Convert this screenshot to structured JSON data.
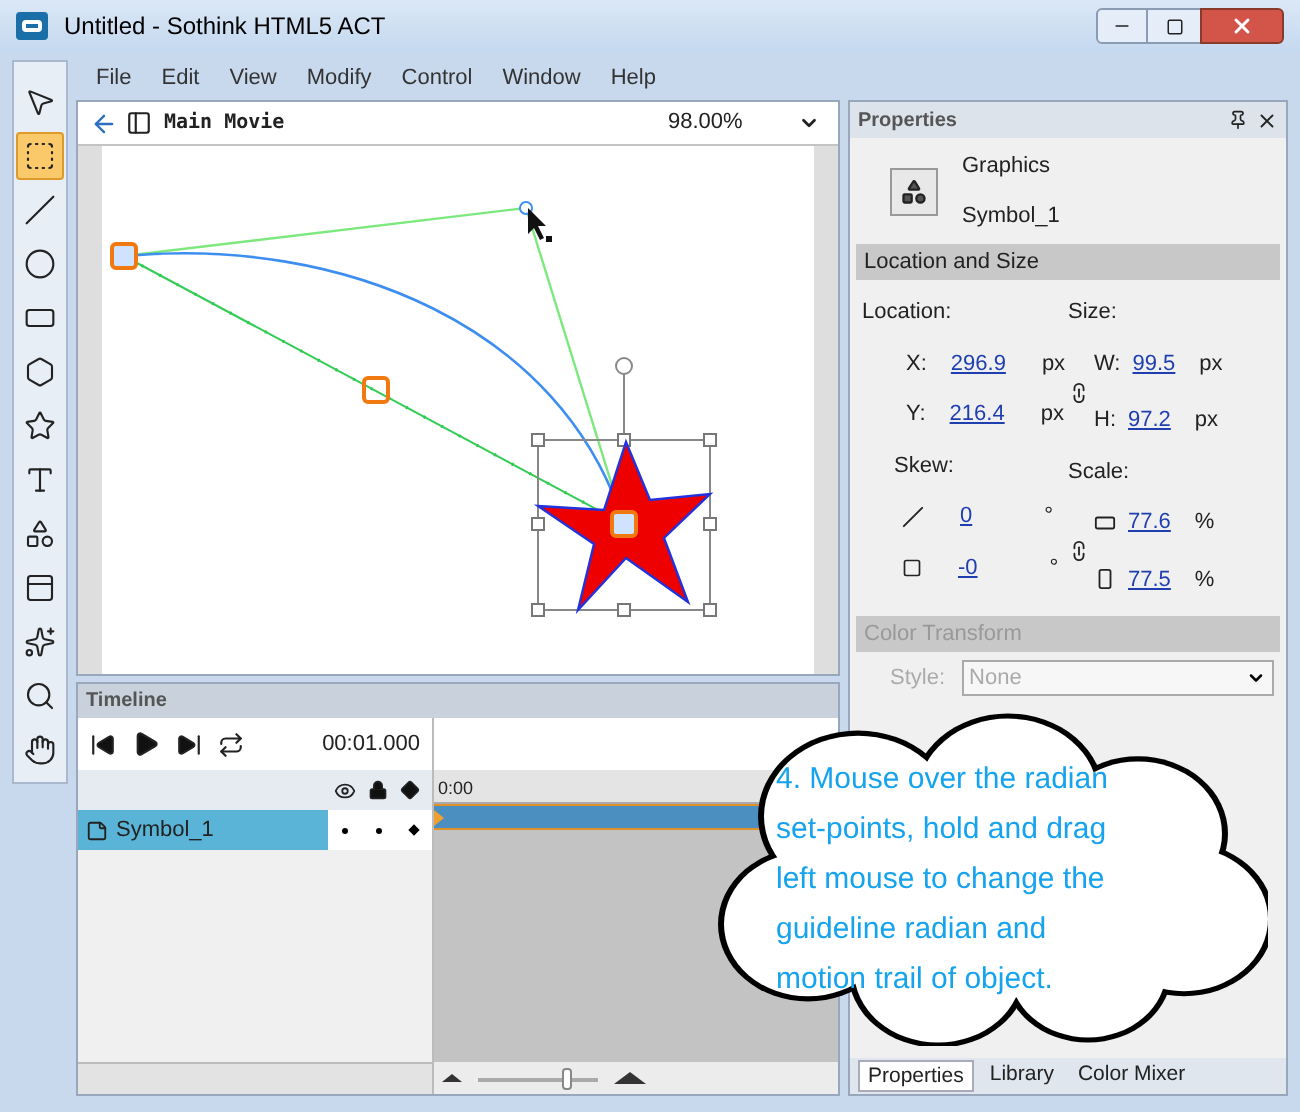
{
  "window": {
    "title": "Untitled - Sothink HTML5 ACT"
  },
  "menu": [
    "File",
    "Edit",
    "View",
    "Modify",
    "Control",
    "Window",
    "Help"
  ],
  "tools": [
    {
      "kind": "pointer",
      "selected": false
    },
    {
      "kind": "transform",
      "selected": true
    },
    {
      "kind": "line",
      "selected": false
    },
    {
      "kind": "ellipse",
      "selected": false
    },
    {
      "kind": "rectangle",
      "selected": false
    },
    {
      "kind": "polygon",
      "selected": false
    },
    {
      "kind": "star",
      "selected": false
    },
    {
      "kind": "text",
      "selected": false
    },
    {
      "kind": "symbol",
      "selected": false
    },
    {
      "kind": "frame",
      "selected": false
    },
    {
      "kind": "effect",
      "selected": false
    },
    {
      "kind": "zoom",
      "selected": false
    },
    {
      "kind": "hand",
      "selected": false
    }
  ],
  "stage": {
    "breadcrumb": "Main Movie",
    "zoom": "98.00%"
  },
  "timeline": {
    "title": "Timeline",
    "time": "00:01.000",
    "ruler_label": "0:00",
    "layers": [
      {
        "name": "Symbol_1",
        "selected": true
      }
    ],
    "zoom_slider": {
      "level": 0.75
    }
  },
  "properties": {
    "title": "Properties",
    "symbol_type": "Graphics",
    "symbol_name": "Symbol_1",
    "section": "Location and Size",
    "location_label": "Location:",
    "size_label": "Size:",
    "skew_label": "Skew:",
    "scale_label": "Scale:",
    "location": [
      {
        "label": "X:",
        "value": "296.9",
        "unit": "px"
      },
      {
        "label": "Y:",
        "value": "216.4",
        "unit": "px"
      }
    ],
    "size": [
      {
        "label": "W:",
        "value": "99.5",
        "unit": "px"
      },
      {
        "label": "H:",
        "value": "97.2",
        "unit": "px"
      }
    ],
    "skew": [
      {
        "value": "0",
        "unit": "°"
      },
      {
        "value": "-0",
        "unit": "°"
      }
    ],
    "scale": [
      {
        "value": "77.6",
        "unit": "%"
      },
      {
        "value": "77.5",
        "unit": "%"
      }
    ],
    "color_transform": {
      "title": "Color Transform",
      "style_label": "Style:",
      "style_value": "None",
      "disabled": true
    },
    "tabs": [
      {
        "label": "Properties",
        "selected": true
      },
      {
        "label": "Library",
        "selected": false
      },
      {
        "label": "Color Mixer",
        "selected": false
      }
    ]
  },
  "callout": {
    "lines": [
      "4. Mouse over the radian",
      "set-points, hold and drag",
      "left mouse to change the",
      "guideline radian and",
      "motion trail of object."
    ]
  }
}
